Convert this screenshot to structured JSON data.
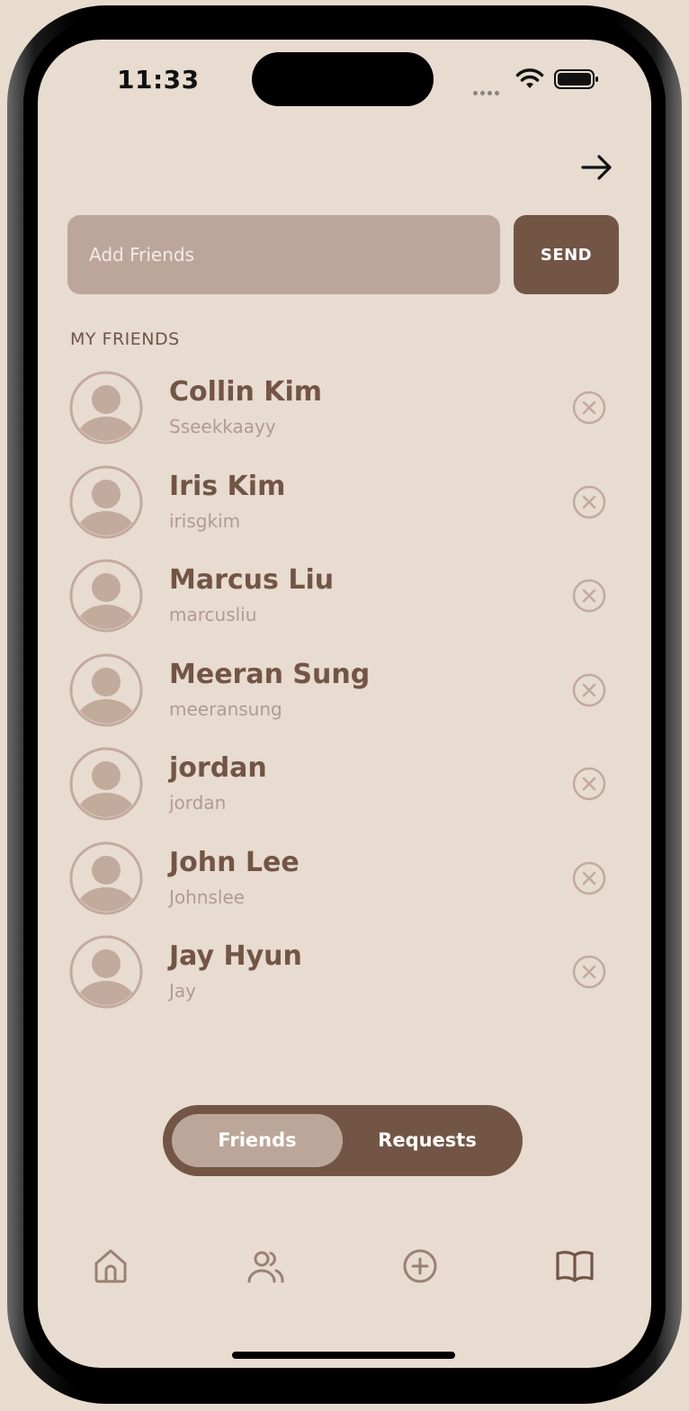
{
  "status_bar": {
    "time": "11:33"
  },
  "search": {
    "placeholder": "Add Friends",
    "send_label": "SEND"
  },
  "section": {
    "title": "MY FRIENDS"
  },
  "friends": [
    {
      "name": "Collin Kim",
      "username": "Sseekkaayy"
    },
    {
      "name": "Iris Kim",
      "username": "irisgkim"
    },
    {
      "name": "Marcus Liu",
      "username": "marcusliu"
    },
    {
      "name": "Meeran Sung",
      "username": "meeransung"
    },
    {
      "name": "jordan",
      "username": "jordan"
    },
    {
      "name": "John Lee",
      "username": "Johnslee"
    },
    {
      "name": "Jay Hyun",
      "username": "Jay"
    }
  ],
  "toggle": {
    "friends_label": "Friends",
    "requests_label": "Requests",
    "selected": "Friends"
  },
  "nav": {
    "items": [
      "home-icon",
      "people-icon",
      "add-circle-icon",
      "book-icon"
    ],
    "active": "book-icon"
  },
  "colors": {
    "background": "#e8dbcf",
    "accent": "#735546",
    "muted": "#bca69a"
  }
}
